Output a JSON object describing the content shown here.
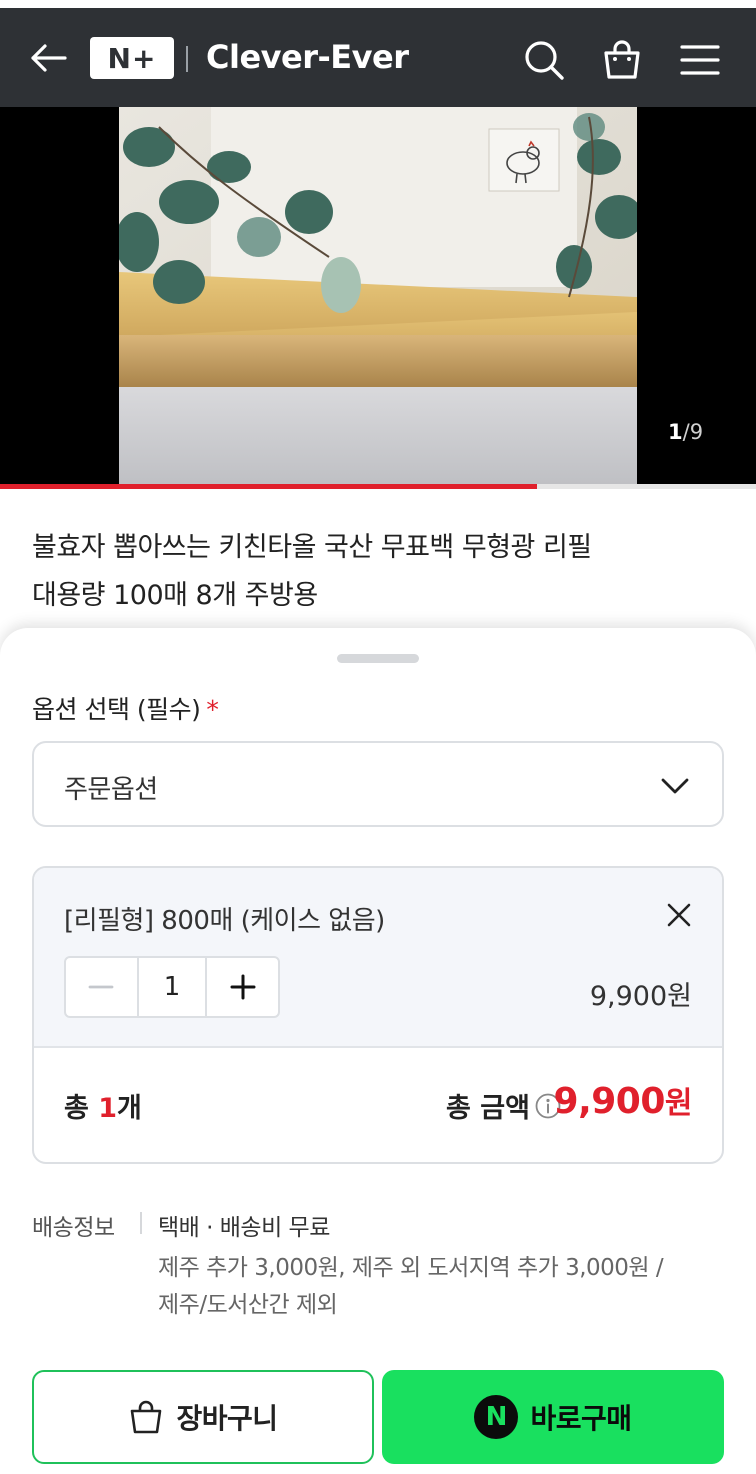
{
  "header": {
    "logo_text": "N+",
    "store_name": "Clever-Ever",
    "icons": [
      "back-arrow-icon",
      "search-icon",
      "shopping-bag-icon",
      "hamburger-menu-icon"
    ]
  },
  "gallery": {
    "current": "1",
    "separator": "/",
    "total": "9",
    "progress": 0.71
  },
  "product": {
    "title_line1": "불효자 뽑아쓰는 키친타올 국산 무표백 무형광 리필",
    "title_line2": "대용량 100매 8개 주방용"
  },
  "options": {
    "label": "옵션 선택 (필수)",
    "required_mark": "*",
    "select_value": "주문옵션"
  },
  "selected_item": {
    "name": "[리필형] 800매 (케이스 없음)",
    "quantity": "1",
    "price": "9,900원"
  },
  "totals": {
    "count_prefix": "총 ",
    "count_value": "1",
    "count_suffix": "개",
    "amount_label": "총 금액",
    "amount_value": "9,900",
    "amount_unit": "원"
  },
  "shipping": {
    "label": "배송정보",
    "main": "택배 · 배송비 무료",
    "note_line1": "제주 추가 3,000원, 제주 외 도서지역 추가 3,000원 /",
    "note_line2": "제주/도서산간 제외"
  },
  "actions": {
    "cart_label": "장바구니",
    "buy_label": "바로구매",
    "buy_badge": "N"
  },
  "colors": {
    "header_bg": "#2e3135",
    "accent_red": "#e0202c",
    "buy_green": "#19e05f"
  }
}
